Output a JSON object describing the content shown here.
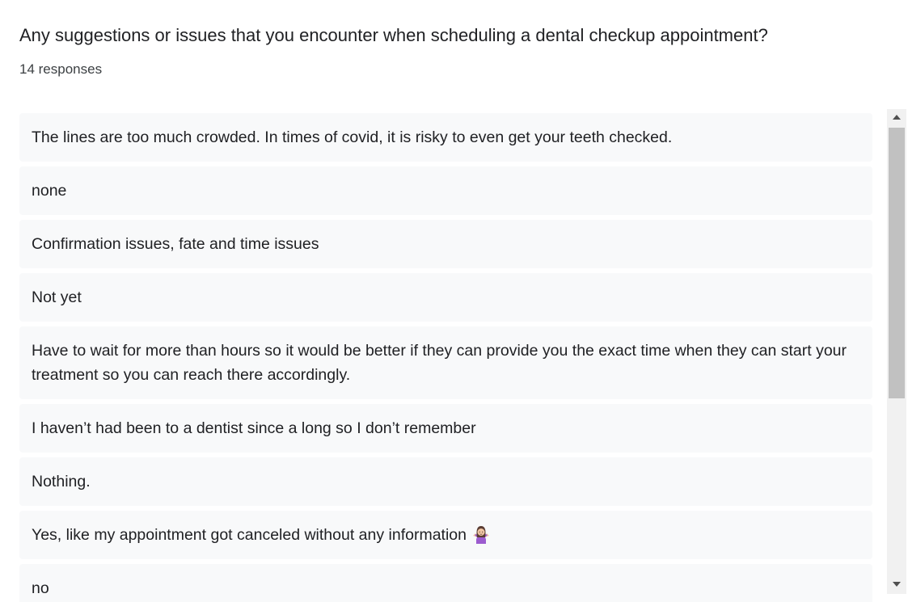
{
  "question": {
    "title": "Any suggestions or issues that you encounter when scheduling a dental checkup appointment?",
    "response_count": "14 responses"
  },
  "responses": [
    "The lines are too much crowded. In times of covid, it is risky to even get your teeth checked.",
    "none",
    "Confirmation issues, fate and time issues",
    "Not yet",
    "Have to wait for more than hours so it would be better if they can provide you the exact time when they can start your treatment so you can reach there accordingly.",
    "I haven’t had been to a dentist since a long so I don’t remember",
    "Nothing.",
    "Yes, like my appointment got canceled without any information",
    "no"
  ],
  "icons": {
    "emoji": "woman-shrugging-icon",
    "scroll_up": "triangle-up-icon",
    "scroll_down": "triangle-down-icon"
  },
  "colors": {
    "card_background": "#f8f9fa",
    "text": "#202124",
    "scrollbar_track": "#f1f1f1",
    "scrollbar_thumb": "#c1c1c1",
    "emoji_shirt": "#9c5ccf",
    "emoji_hair": "#5a3d33"
  },
  "scroll": {
    "thumb_position_fraction": 0.0,
    "visible_fraction": 0.57
  }
}
